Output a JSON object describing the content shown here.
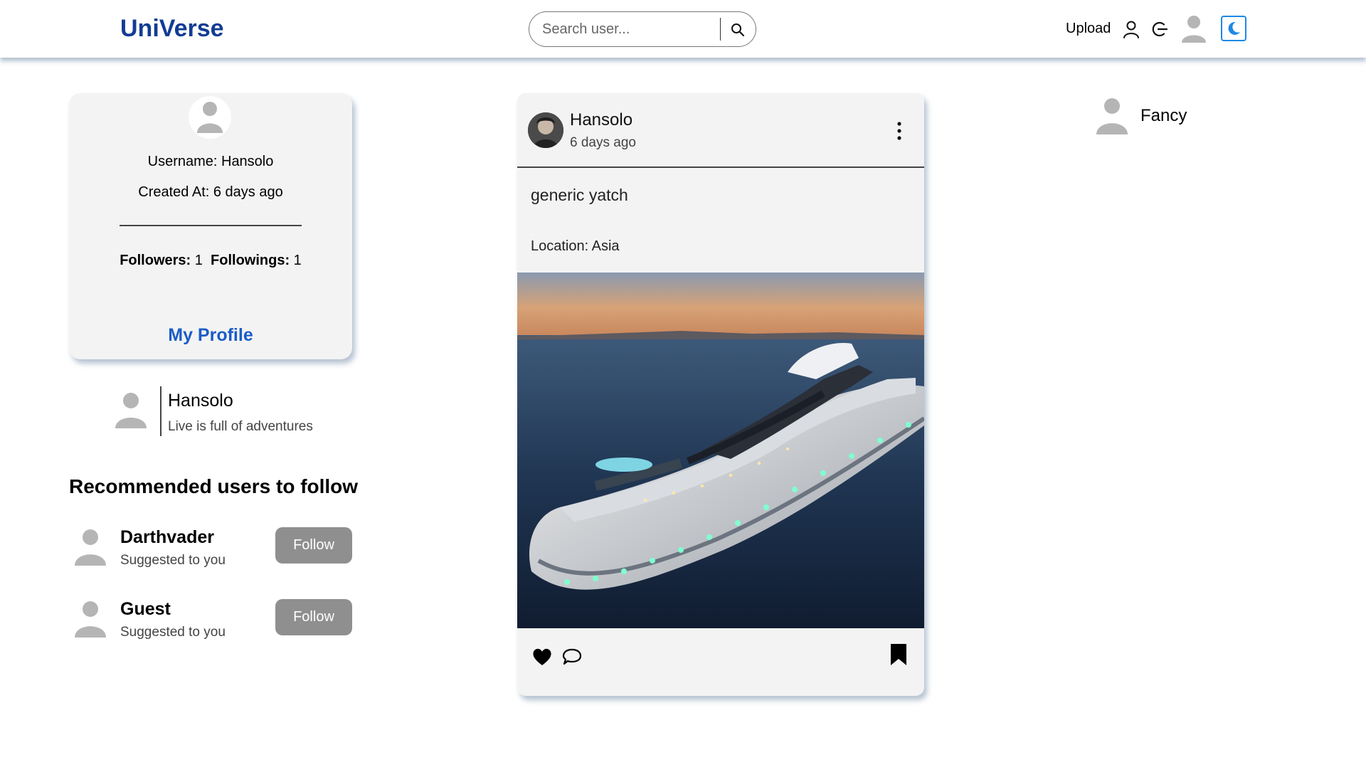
{
  "header": {
    "logo": "UniVerse",
    "search_placeholder": "Search user...",
    "upload_label": "Upload"
  },
  "profile_card": {
    "username_label": "Username: Hansolo",
    "created_label": "Created At: 6 days ago",
    "followers_label": "Followers:",
    "followers_count": "1",
    "followings_label": "Followings:",
    "followings_count": "1",
    "my_profile_link": "My Profile"
  },
  "bio": {
    "name": "Hansolo",
    "text": "Live is full of adventures"
  },
  "recommended": {
    "title": "Recommended users to follow",
    "users": [
      {
        "name": "Darthvader",
        "subtitle": "Suggested to you",
        "button": "Follow"
      },
      {
        "name": "Guest",
        "subtitle": "Suggested to you",
        "button": "Follow"
      }
    ]
  },
  "post": {
    "author": "Hansolo",
    "time": "6 days ago",
    "caption": "generic yatch",
    "location": "Location: Asia"
  },
  "right_panel": {
    "users": [
      {
        "name": "Fancy"
      }
    ]
  },
  "colors": {
    "logo": "#123c94",
    "link": "#1a5cc8",
    "follow_button": "#8f8f8f",
    "card_bg": "#f3f3f3",
    "theme_toggle": "#1e88e5"
  },
  "icons": {
    "search": "search-icon",
    "profile": "user-icon",
    "logout": "logout-icon",
    "theme": "moon-icon",
    "like": "heart-icon",
    "comment": "comment-icon",
    "save": "bookmark-icon",
    "menu": "more-vertical-icon"
  }
}
